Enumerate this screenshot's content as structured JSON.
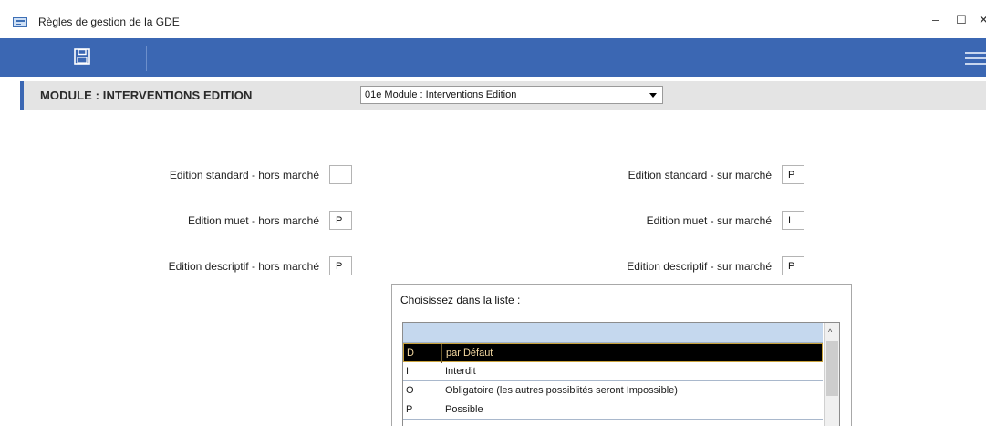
{
  "window": {
    "title": "Règles de gestion de la GDE",
    "controls": {
      "minimize": "–",
      "maximize": "☐",
      "close": "✕"
    }
  },
  "toolbar": {
    "icons": [
      "save-icon",
      "hamburger-menu-icon"
    ]
  },
  "module": {
    "title": "MODULE : INTERVENTIONS EDITION",
    "select_value": "01e  Module : Interventions Edition"
  },
  "fields": {
    "left": [
      {
        "label": "Edition standard - hors marché",
        "value": ""
      },
      {
        "label": "Edition muet - hors marché",
        "value": "P"
      },
      {
        "label": "Edition descriptif - hors marché",
        "value": "P"
      }
    ],
    "right": [
      {
        "label": "Edition standard - sur marché",
        "value": "P"
      },
      {
        "label": "Edition muet - sur marché",
        "value": "I"
      },
      {
        "label": "Edition descriptif - sur marché",
        "value": "P"
      }
    ]
  },
  "popup": {
    "title": "Choisissez dans la liste :",
    "rows": [
      {
        "code": "D",
        "label": "par Défaut",
        "selected": true
      },
      {
        "code": "I",
        "label": "Interdit",
        "selected": false
      },
      {
        "code": "O",
        "label": "Obligatoire (les autres possiblités seront Impossible)",
        "selected": false
      },
      {
        "code": "P",
        "label": "Possible",
        "selected": false
      }
    ],
    "scroll_up": "^"
  },
  "colors": {
    "toolbar": "#3b67b3",
    "module_bar": "#e4e4e4",
    "grid_header": "#c5d8ee",
    "selected_row": "#000000",
    "selected_text": "#f3d8a0"
  }
}
